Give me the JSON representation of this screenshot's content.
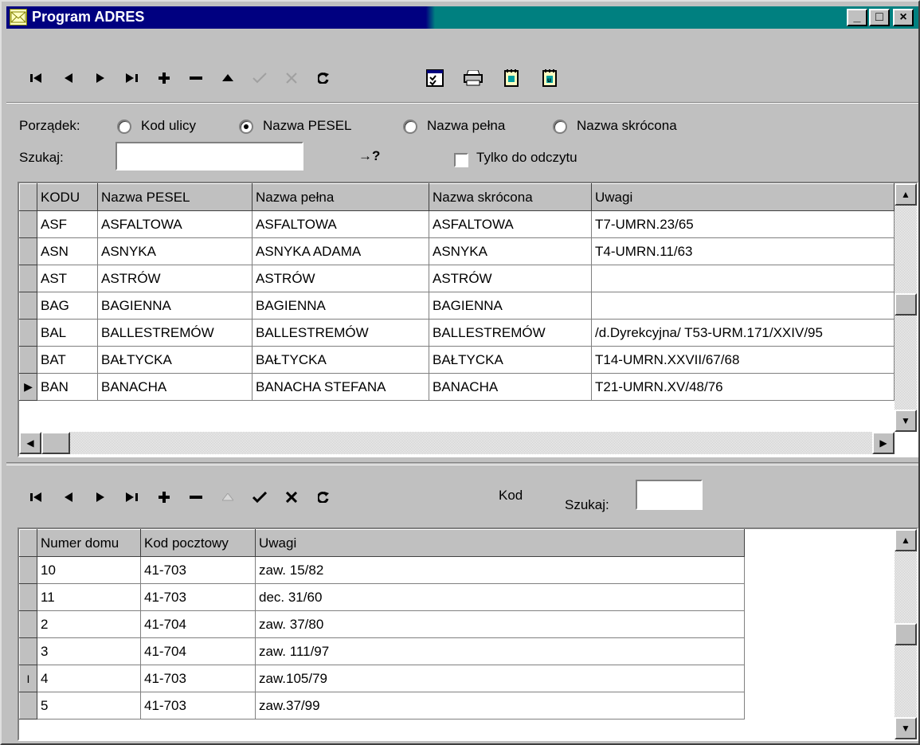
{
  "window": {
    "title": "Program ADRES",
    "minimize_label": "_",
    "maximize_label": "□",
    "close_label": "×"
  },
  "top_toolbar": {
    "first": "⏮",
    "prior": "◀",
    "next": "▶",
    "last": "⏭",
    "insert": "+",
    "delete": "−",
    "edit": "▲",
    "post": "✓",
    "cancel": "✕",
    "refresh": "↻"
  },
  "order": {
    "label": "Porządek:",
    "options": [
      "Kod ulicy",
      "Nazwa PESEL",
      "Nazwa pełna",
      "Nazwa skrócona"
    ],
    "selected": "Nazwa PESEL"
  },
  "search": {
    "label": "Szukaj:",
    "value": "",
    "go_label": "→?",
    "readonly_label": "Tylko do odczytu"
  },
  "streets": {
    "columns": [
      "KODU",
      "Nazwa PESEL",
      "Nazwa pełna",
      "Nazwa skrócona",
      "Uwagi"
    ],
    "rows": [
      [
        "ASF",
        "ASFALTOWA",
        "ASFALTOWA",
        "ASFALTOWA",
        "T7-UMRN.23/65"
      ],
      [
        "ASN",
        "ASNYKA",
        "ASNYKA ADAMA",
        "ASNYKA",
        "T4-UMRN.11/63"
      ],
      [
        "AST",
        "ASTRÓW",
        "ASTRÓW",
        "ASTRÓW",
        ""
      ],
      [
        "BAG",
        "BAGIENNA",
        "BAGIENNA",
        "BAGIENNA",
        ""
      ],
      [
        "BAL",
        "BALLESTREMÓW",
        "BALLESTREMÓW",
        "BALLESTREMÓW",
        "/d.Dyrekcyjna/  T53-URM.171/XXIV/95"
      ],
      [
        "BAT",
        "BAŁTYCKA",
        "BAŁTYCKA",
        "BAŁTYCKA",
        "T14-UMRN.XXVII/67/68"
      ],
      [
        "BAN",
        "BANACHA",
        "BANACHA STEFANA",
        "BANACHA",
        "T21-UMRN.XV/48/76"
      ]
    ],
    "current_row": 6
  },
  "bottom_toolbar": {
    "kod_label": "Kod",
    "search_label": "Szukaj:",
    "search_value": ""
  },
  "houses": {
    "columns": [
      "Numer domu",
      "Kod pocztowy",
      "Uwagi"
    ],
    "rows": [
      [
        "10",
        "41-703",
        "zaw. 15/82"
      ],
      [
        "11",
        "41-703",
        "dec. 31/60"
      ],
      [
        "2",
        "41-704",
        "zaw. 37/80"
      ],
      [
        "3",
        "41-704",
        "zaw. 111/97"
      ],
      [
        "4",
        "41-703",
        "zaw.105/79"
      ],
      [
        "5",
        "41-703",
        "zaw.37/99"
      ]
    ],
    "current_row": 4
  }
}
